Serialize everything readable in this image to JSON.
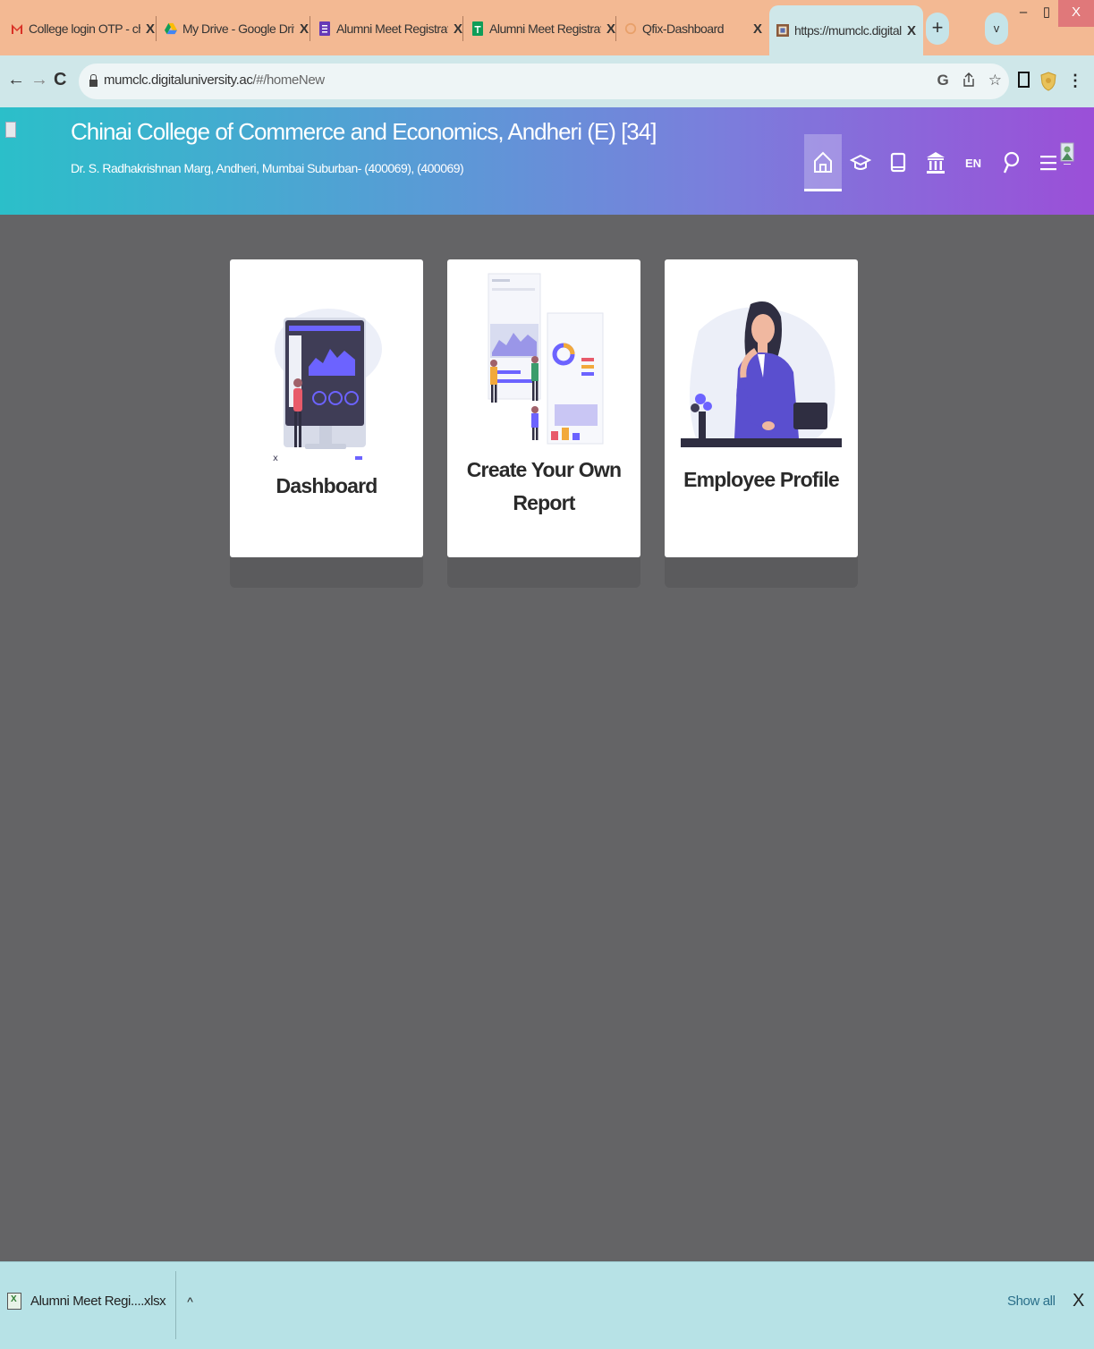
{
  "browser": {
    "tabs": [
      {
        "title": "College login OTP - china",
        "icon": "gmail-icon"
      },
      {
        "title": "My Drive - Google Drive",
        "icon": "google-drive-icon"
      },
      {
        "title": "Alumni Meet Registration",
        "icon": "google-forms-icon"
      },
      {
        "title": "Alumni Meet Registration",
        "icon": "google-sheets-icon"
      },
      {
        "title": "Qfix-Dashboard",
        "icon": "loading-icon"
      },
      {
        "title": "https://mumclc.digitaluni",
        "icon": "site-favicon",
        "active": true
      }
    ],
    "tab_close": "X",
    "new_tab": "+",
    "tab_search": "v",
    "window": {
      "minimize": "–",
      "maximize": "▯",
      "close": "X"
    },
    "url_host": "mumclc.digitaluniversity.ac",
    "url_path": "/#/homeNew",
    "omnibox_icons": [
      "google-lens-icon",
      "share-icon",
      "bookmark-star-icon"
    ],
    "extension_icons": [
      "sidepanel-icon",
      "extension-shield-icon",
      "kebab-menu-icon"
    ]
  },
  "header": {
    "title": "Chinai College of Commerce and Economics, Andheri (E) [34]",
    "address": "Dr. S. Radhakrishnan Marg, Andheri, Mumbai Suburban- (400069), (400069)",
    "language": "EN",
    "nav_icons": [
      "home-icon",
      "graduation-cap-icon",
      "book-icon",
      "institution-icon",
      "language-icon",
      "search-icon",
      "menu-icon",
      "avatar"
    ]
  },
  "cards": [
    {
      "label_line1": "Dashboard",
      "label_line2": "",
      "illustration": "dashboard-illustration"
    },
    {
      "label_line1": "Create Your Own",
      "label_line2": "Report",
      "illustration": "report-illustration"
    },
    {
      "label_line1": "Employee Profile",
      "label_line2": "",
      "illustration": "employee-illustration"
    }
  ],
  "downloads": {
    "file": "Alumni Meet Regi....xlsx",
    "caret": "^",
    "show_all": "Show all",
    "close": "X"
  },
  "colors": {
    "header_gradient_start": "#2bbfc9",
    "header_gradient_end": "#9b4fd8",
    "page_background": "#646466",
    "tabstrip": "#f3b993",
    "toolbar": "#cfe7e9"
  }
}
